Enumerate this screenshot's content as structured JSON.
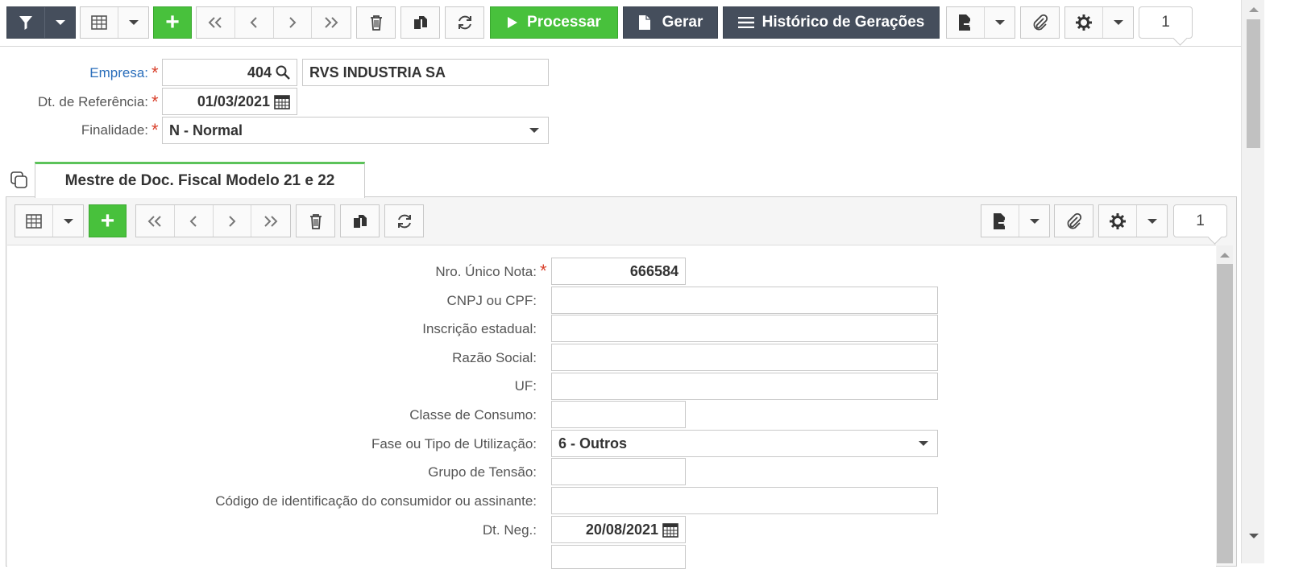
{
  "toolbar": {
    "processar_label": "Processar",
    "gerar_label": "Gerar",
    "historico_label": "Histórico de Gerações",
    "page_number": "1"
  },
  "header_form": {
    "empresa_label": "Empresa:",
    "empresa_code": "404",
    "empresa_name": "RVS INDUSTRIA SA",
    "dt_ref_label": "Dt. de Referência:",
    "dt_ref_value": "01/03/2021",
    "finalidade_label": "Finalidade:",
    "finalidade_value": "N - Normal"
  },
  "tab": {
    "label": "Mestre de Doc. Fiscal Modelo 21 e 22"
  },
  "sub_toolbar": {
    "page_number": "1"
  },
  "detail_form": {
    "nro_unico_label": "Nro. Único Nota:",
    "nro_unico_value": "666584",
    "cnpj_label": "CNPJ ou CPF:",
    "cnpj_value": "",
    "inscricao_label": "Inscrição estadual:",
    "inscricao_value": "",
    "razao_label": "Razão Social:",
    "razao_value": "",
    "uf_label": "UF:",
    "uf_value": "",
    "classe_label": "Classe de Consumo:",
    "classe_value": "",
    "fase_label": "Fase ou Tipo de Utilização:",
    "fase_value": "6 - Outros",
    "grupo_label": "Grupo de Tensão:",
    "grupo_value": "",
    "codigo_label": "Código de identificação do consumidor ou assinante:",
    "codigo_value": "",
    "dtneg_label": "Dt. Neg.:",
    "dtneg_value": "20/08/2021"
  },
  "colors": {
    "dark_button": "#454e5c",
    "green_button": "#48c13c",
    "link_blue": "#2a6ebb",
    "required_red": "#d9402b",
    "tab_accent": "#5cc35a"
  }
}
